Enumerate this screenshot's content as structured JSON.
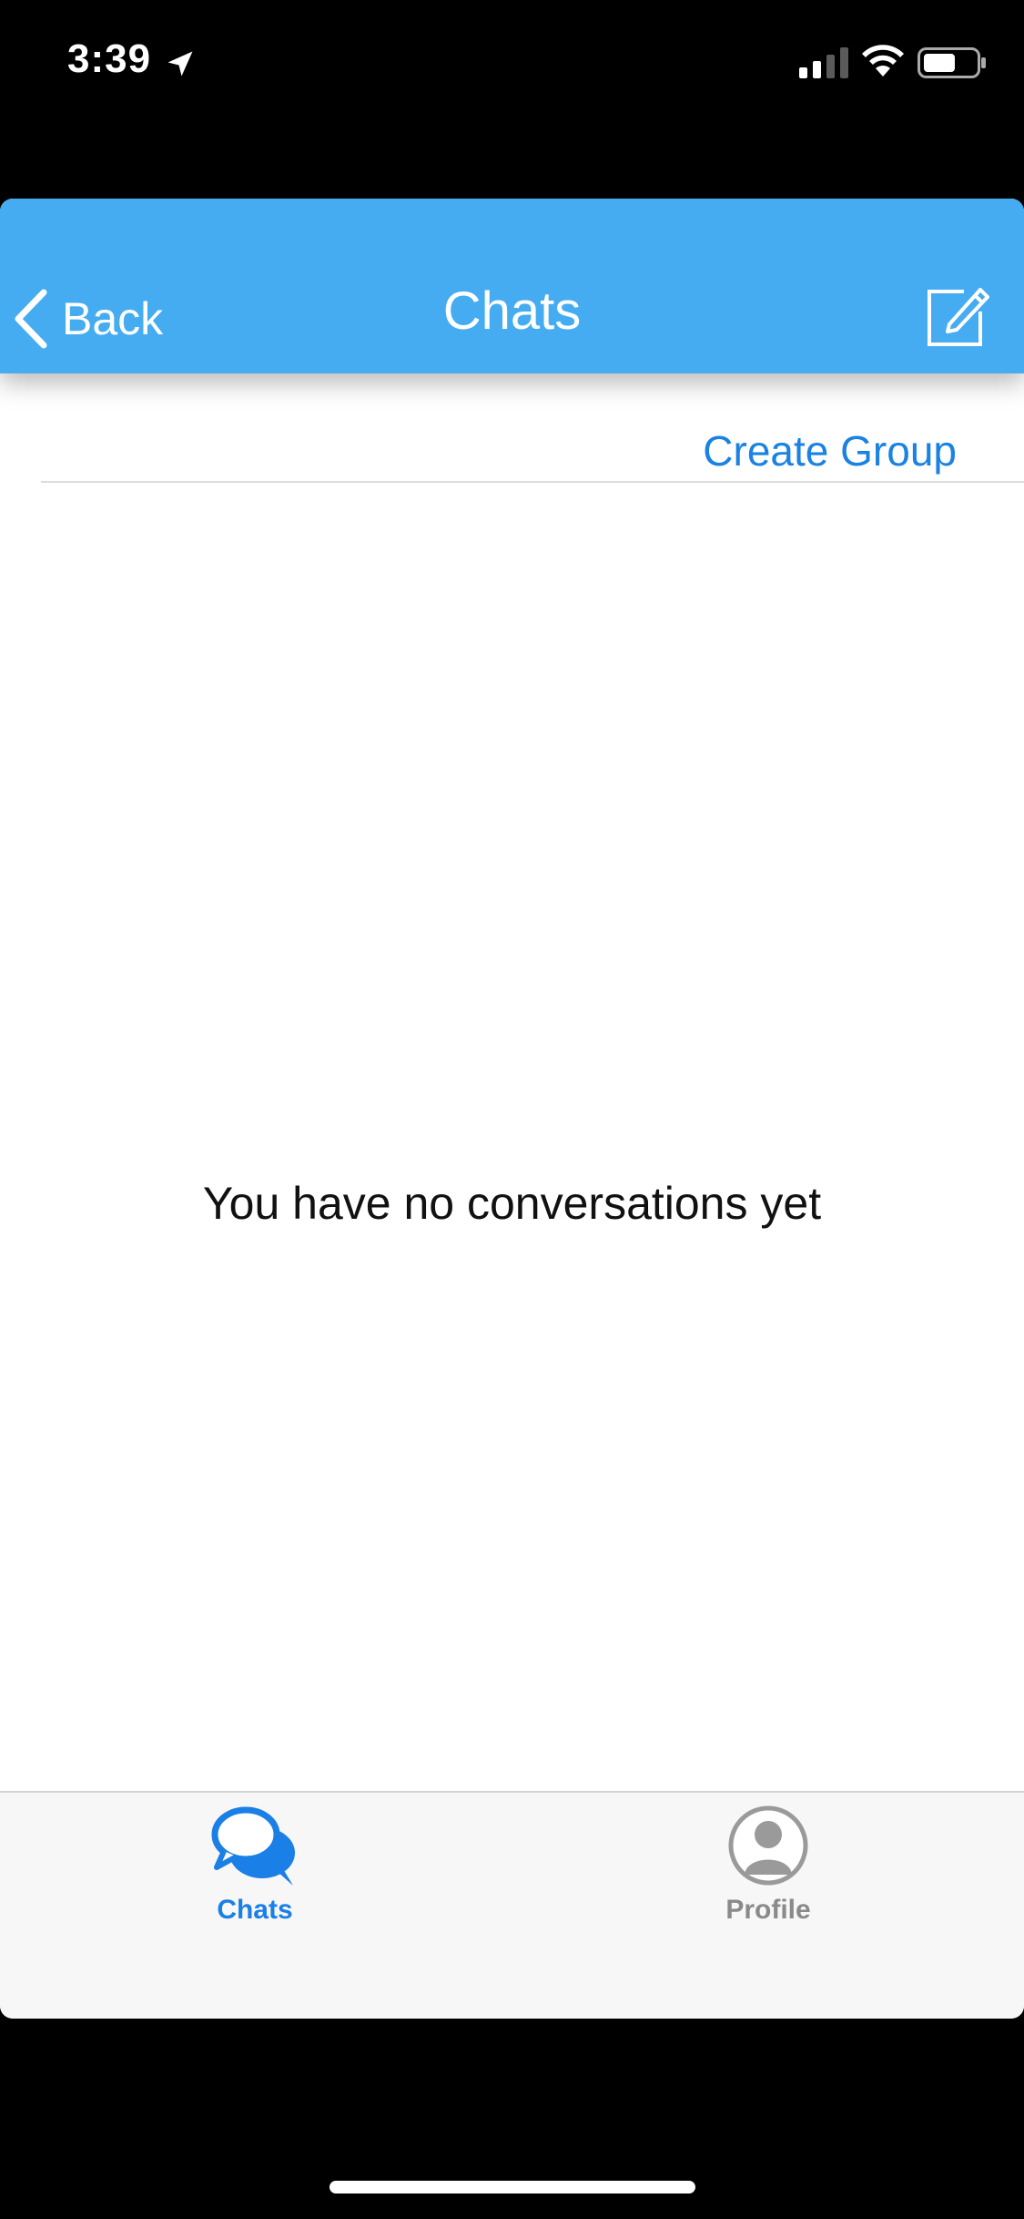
{
  "status_bar": {
    "time": "3:39",
    "location_icon": "location-arrow-icon",
    "signal_icon": "cellular-signal-icon",
    "wifi_icon": "wifi-icon",
    "battery_icon": "battery-icon"
  },
  "nav_bar": {
    "back_label": "Back",
    "title": "Chats",
    "compose_icon": "compose-icon",
    "background_color": "#45acf2"
  },
  "subheader": {
    "create_group_label": "Create Group",
    "link_color": "#1a82e2"
  },
  "main": {
    "empty_message": "You have no conversations yet"
  },
  "tab_bar": {
    "tabs": [
      {
        "label": "Chats",
        "icon": "chat-bubbles-icon",
        "selected": true
      },
      {
        "label": "Profile",
        "icon": "profile-icon",
        "selected": false
      }
    ],
    "selected_color": "#1a7fe6",
    "unselected_color": "#8a8a8a"
  }
}
